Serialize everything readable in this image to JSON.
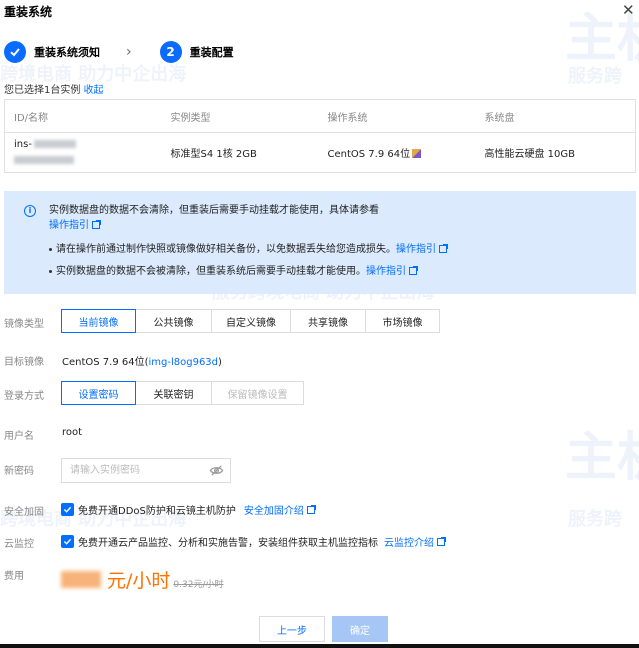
{
  "dialog": {
    "title": "重装系统",
    "close_icon": "close-icon"
  },
  "steps": [
    {
      "label": "重装系统须知",
      "state": "done"
    },
    {
      "number": "2",
      "label": "重装配置",
      "state": "current"
    }
  ],
  "selection": {
    "text": "您已选择1台实例",
    "collapse_link": "收起"
  },
  "instance_table": {
    "headers": [
      "ID/名称",
      "实例类型",
      "操作系统",
      "系统盘"
    ],
    "rows": [
      {
        "id_prefix": "ins-",
        "type": "标准型S4 1核 2GB",
        "os": "CentOS 7.9 64位",
        "disk": "高性能云硬盘 10GB"
      }
    ]
  },
  "notice": {
    "main_text": "实例数据盘的数据不会清除，但重装后需要手动挂载才能使用，具体请参看",
    "main_link": "操作指引",
    "bullets": [
      {
        "text": "请在操作前通过制作快照或镜像做好相关备份，以免数据丢失给您造成损失。",
        "link": "操作指引"
      },
      {
        "text": "实例数据盘的数据不会被清除，但重装系统后需要手动挂载才能使用。",
        "link": "操作指引"
      }
    ]
  },
  "image_type": {
    "label": "镜像类型",
    "options": [
      "当前镜像",
      "公共镜像",
      "自定义镜像",
      "共享镜像",
      "市场镜像"
    ],
    "selected": "当前镜像"
  },
  "target_image": {
    "label": "目标镜像",
    "value_prefix": "CentOS 7.9 64位(",
    "value_link": "img-l8og963d",
    "value_suffix": ")"
  },
  "login_method": {
    "label": "登录方式",
    "options": [
      "设置密码",
      "关联密钥",
      "保留镜像设置"
    ],
    "selected": "设置密码",
    "disabled": "保留镜像设置"
  },
  "username": {
    "label": "用户名",
    "value": "root"
  },
  "password": {
    "label": "新密码",
    "placeholder": "请输入实例密码"
  },
  "security": {
    "label": "安全加固",
    "text": "免费开通DDoS防护和云镜主机防护",
    "link": "安全加固介绍"
  },
  "monitoring": {
    "label": "云监控",
    "text": "免费开通云产品监控、分析和实施告警，安装组件获取主机监控指标",
    "link": "云监控介绍"
  },
  "fee": {
    "label": "费用",
    "unit": "元/小时",
    "original": "0.32元/小时"
  },
  "footer": {
    "prev_label": "上一步",
    "confirm_label": "确定"
  },
  "watermark": {
    "brand": "主机",
    "line1": "跨境电商 助力中企出海",
    "line2": "服务跨境电商 助力中企出海",
    "line3": "服务跨"
  },
  "colors": {
    "primary": "#006eff",
    "notice_bg": "#dbeafc",
    "price": "#ff7200"
  }
}
